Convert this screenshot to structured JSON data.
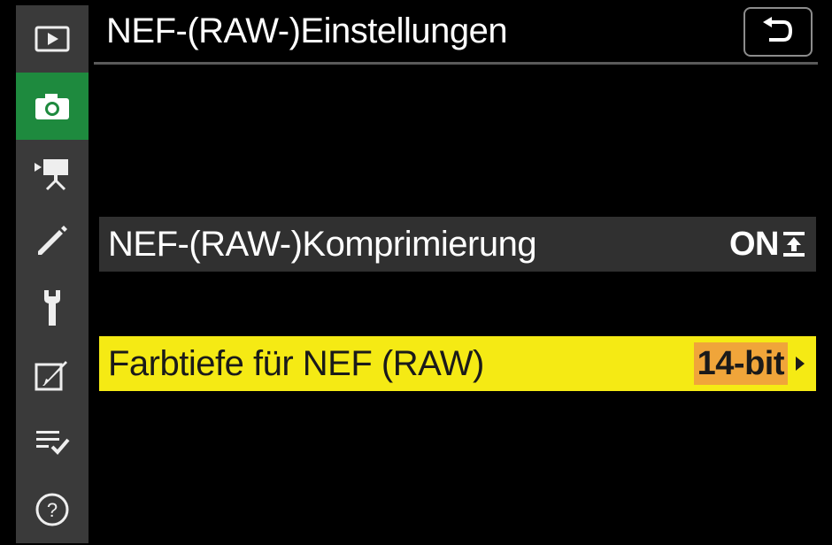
{
  "header": {
    "title": "NEF-(RAW-)Einstellungen",
    "back_icon": "return-arrow-icon"
  },
  "sidebar": {
    "items": [
      {
        "icon": "playback-icon",
        "active": false
      },
      {
        "icon": "camera-icon",
        "active": true
      },
      {
        "icon": "movie-camera-icon",
        "active": false
      },
      {
        "icon": "pencil-icon",
        "active": false
      },
      {
        "icon": "wrench-icon",
        "active": false
      },
      {
        "icon": "retouch-icon",
        "active": false
      },
      {
        "icon": "my-menu-icon",
        "active": false
      },
      {
        "icon": "help-icon",
        "active": false
      }
    ]
  },
  "menu": {
    "items": [
      {
        "label": "NEF-(RAW-)Komprimierung",
        "value": "ON",
        "value_icon": "compression-icon",
        "selected": false
      },
      {
        "label": "Farbtiefe für NEF (RAW)",
        "value": "14-bit",
        "value_icon": "chevron-right-icon",
        "selected": true
      }
    ]
  },
  "colors": {
    "sidebar_bg": "#3a3a3a",
    "active_tab": "#1e8a3e",
    "selected_row": "#f5ea14",
    "value_highlight": "#f0a53a",
    "row_bg": "#303030"
  }
}
